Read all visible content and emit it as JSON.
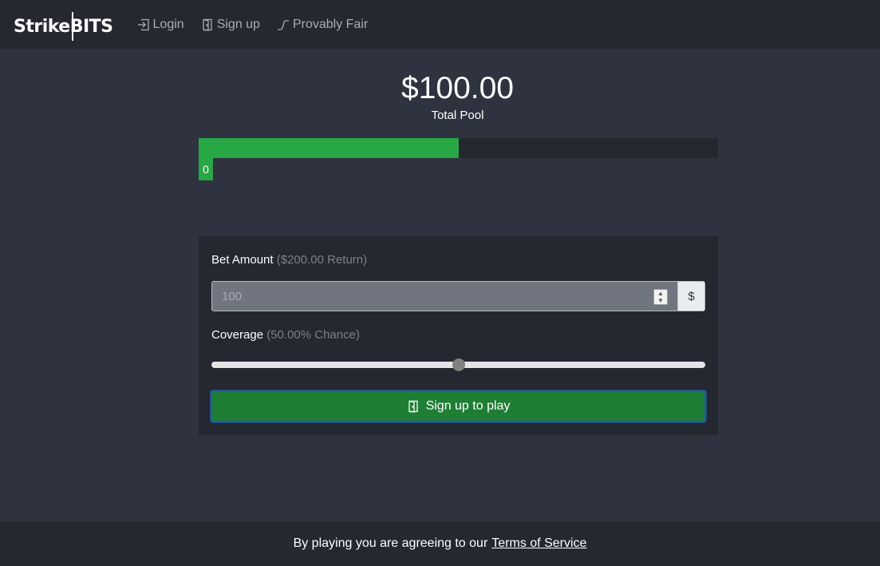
{
  "brand": {
    "part1": "Strike",
    "part2": "BITS"
  },
  "nav": {
    "items": [
      {
        "label": "Login",
        "icon": "login-icon"
      },
      {
        "label": "Sign up",
        "icon": "door-icon"
      },
      {
        "label": "Provably Fair",
        "icon": "fair-curve-icon"
      }
    ]
  },
  "pool": {
    "amount": "$100.00",
    "label": "Total Pool",
    "fill_fraction": 0.5,
    "marker": "0"
  },
  "bet": {
    "label": "Bet Amount",
    "return_text": "($200.00 Return)",
    "placeholder": "100",
    "currency": "$"
  },
  "coverage": {
    "label": "Coverage",
    "chance_text": "(50.00% Chance)",
    "value_fraction": 0.5
  },
  "action": {
    "label": "Sign up to play",
    "icon": "door-icon"
  },
  "footer": {
    "text": "By playing you are agreeing to our",
    "link": "Terms of Service"
  },
  "colors": {
    "accent_green": "#28a745",
    "button_green": "#1e7e34",
    "background": "#2f323f",
    "panel": "#252731"
  }
}
